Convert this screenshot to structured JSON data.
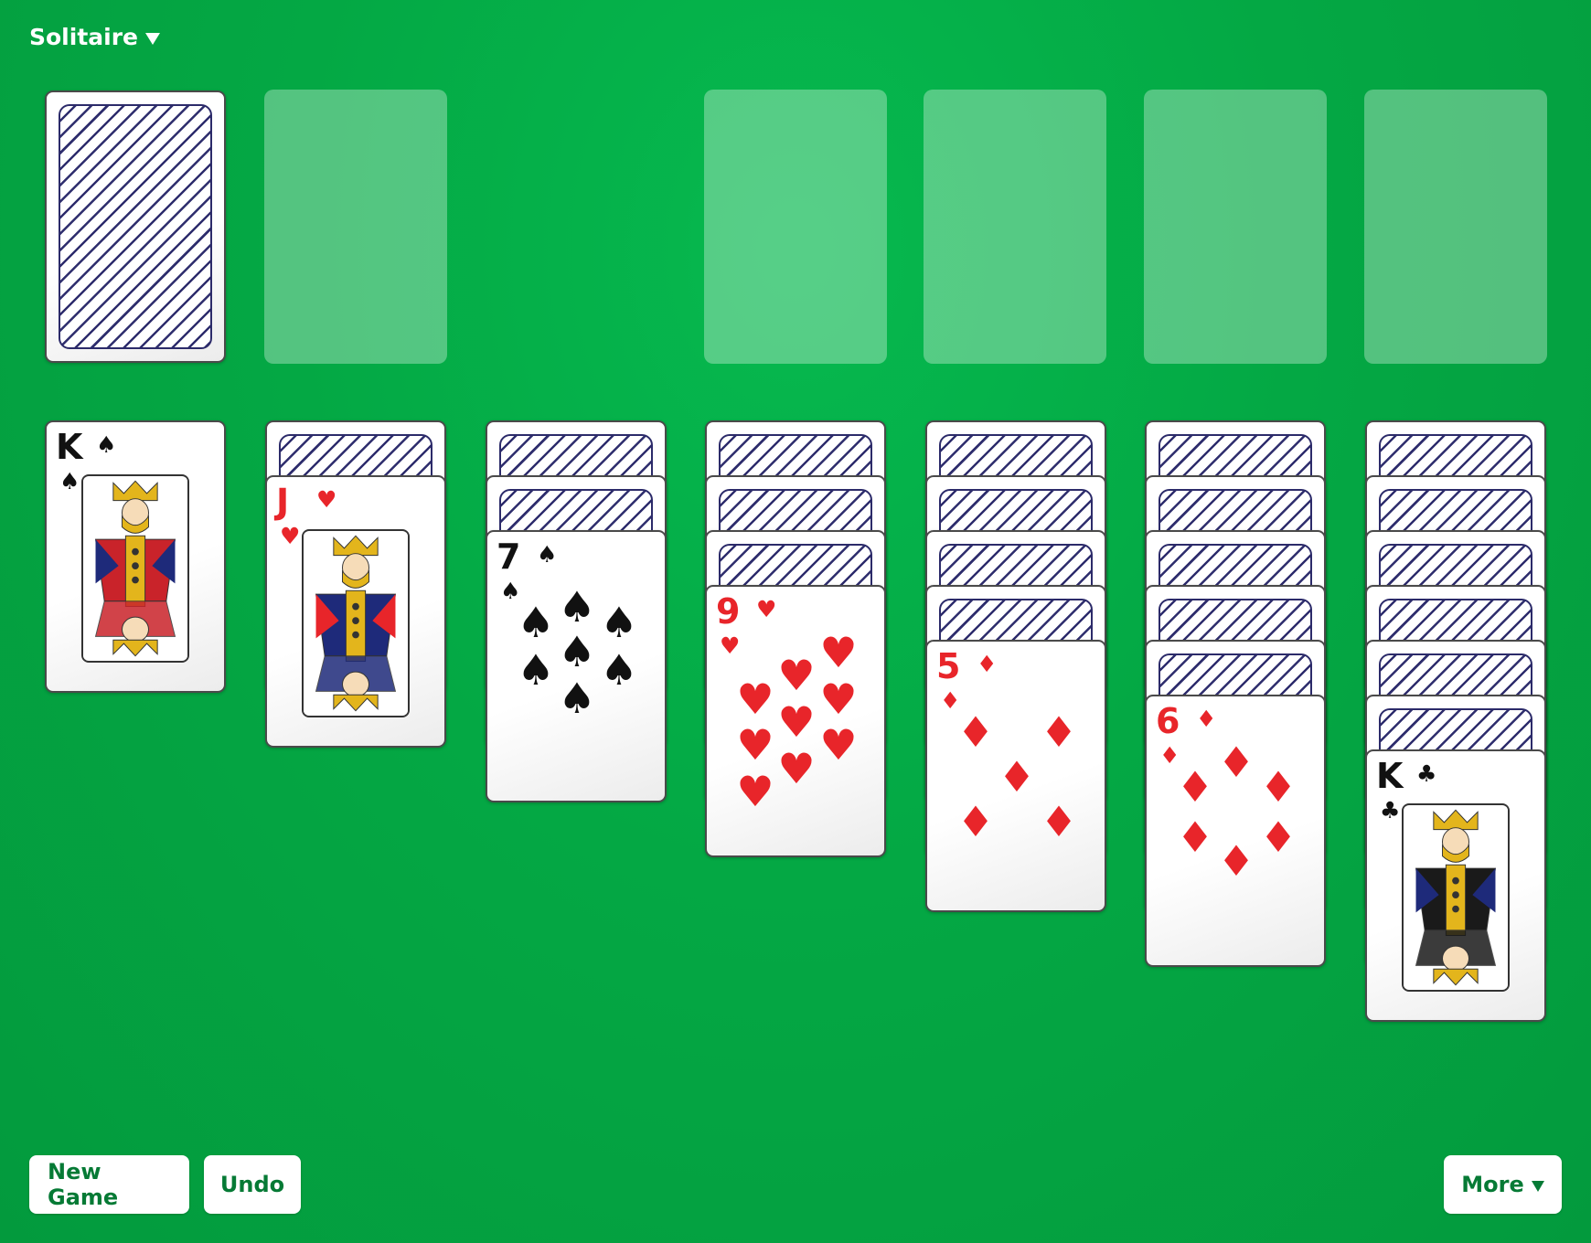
{
  "app": {
    "title": "Solitaire"
  },
  "buttons": {
    "new_game": "New Game",
    "undo": "Undo",
    "more": "More"
  },
  "colors": {
    "felt": "#04a844",
    "button_text": "#067a35",
    "red_suit": "#e8252a",
    "black_suit": "#111111",
    "card_back_stripe": "#2e2d6d"
  },
  "stock": {
    "cards": "face-down"
  },
  "foundations": [
    "empty",
    "empty",
    "empty",
    "empty"
  ],
  "waste": "empty",
  "tableau": [
    {
      "hidden": 0,
      "top": {
        "rank": "K",
        "suit": "spade",
        "symbol": "♠",
        "color": "black",
        "face": "king-spades"
      }
    },
    {
      "hidden": 1,
      "top": {
        "rank": "J",
        "suit": "heart",
        "symbol": "♥",
        "color": "red",
        "face": "jack-hearts"
      }
    },
    {
      "hidden": 2,
      "top": {
        "rank": "7",
        "suit": "spade",
        "symbol": "♠",
        "color": "black"
      }
    },
    {
      "hidden": 3,
      "top": {
        "rank": "9",
        "suit": "heart",
        "symbol": "♥",
        "color": "red"
      }
    },
    {
      "hidden": 4,
      "top": {
        "rank": "5",
        "suit": "diamond",
        "symbol": "♦",
        "color": "red"
      }
    },
    {
      "hidden": 5,
      "top": {
        "rank": "6",
        "suit": "diamond",
        "symbol": "♦",
        "color": "red"
      }
    },
    {
      "hidden": 6,
      "top": {
        "rank": "K",
        "suit": "club",
        "symbol": "♣",
        "color": "black",
        "face": "king-clubs"
      }
    }
  ]
}
